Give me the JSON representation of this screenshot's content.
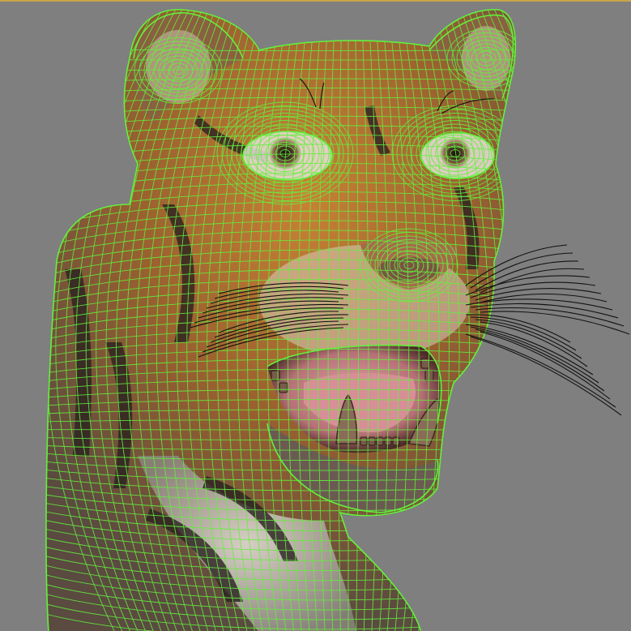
{
  "viewport": {
    "background": "#7f7f7f",
    "frame_highlight": "#c8a44a"
  },
  "model": {
    "subject": "tiger",
    "render_mode": "textured-with-wireframe-overlay",
    "wire_color": "#63f03c",
    "fur_orange": "#b86b2a",
    "fur_light": "#e8ddd0",
    "stripe_dark": "#2a2220",
    "mouth_pink": "#c97a86",
    "tooth_color": "#8a6a58",
    "whisker_color": "#111111"
  }
}
